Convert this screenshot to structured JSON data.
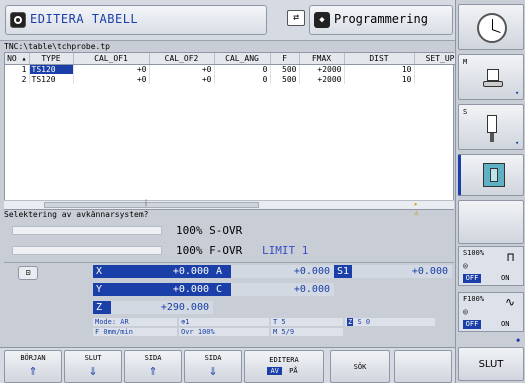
{
  "title": {
    "mode_left": "EDITERA TABELL",
    "mode_right": "Programmering"
  },
  "file_path": "TNC:\\table\\tchprobe.tp",
  "table": {
    "columns": [
      "NO",
      "TYPE",
      "CAL_OF1",
      "CAL_OF2",
      "CAL_ANG",
      "F",
      "FMAX",
      "DIST",
      "SET_UP"
    ],
    "rows": [
      [
        "1",
        "TS120",
        "+0",
        "+0",
        "0",
        "500",
        "+2000",
        "10",
        ""
      ],
      [
        "2",
        "TS120",
        "+0",
        "+0",
        "0",
        "500",
        "+2000",
        "10",
        ""
      ]
    ]
  },
  "scroll_marker": "║",
  "message": "Selektering av avkännarsystem?",
  "override": {
    "s_ovr": "100% S-OVR",
    "f_ovr": "100% F-OVR",
    "limit": "LIMIT 1",
    "s_ovr_level": 100,
    "f_ovr_level": 100
  },
  "positions": {
    "x_label": "X",
    "x_value": "+0.000",
    "a_label": "A",
    "a_value": "+0.000",
    "s1_label": "S1",
    "s1_value": "+0.000",
    "y_label": "Y",
    "y_value": "+0.000",
    "c_label": "C",
    "c_value": "+0.000",
    "z_label": "Z",
    "z_value": "+290.000"
  },
  "status": {
    "mode": "Mode: ÄR",
    "plane": "1",
    "t": "T 5",
    "s": "S 0",
    "feed": "F 0mm/min",
    "ovr": "Ovr 100%",
    "m": "M 5/9"
  },
  "softkeys": {
    "begin": "BÖRJAN",
    "end": "SLUT",
    "page_up": "SIDA",
    "page_down": "SIDA",
    "edit": "EDITERA",
    "edit_av": "AV",
    "edit_pa": "PÅ",
    "search": "SÖK",
    "end_right": "SLUT"
  },
  "right_panel": {
    "m_label": "M",
    "s_label": "S",
    "s100": "S100%",
    "f100": "F100%",
    "off": "OFF",
    "on": "ON"
  },
  "colors": {
    "accent": "#1a3fa8",
    "panel": "#c9ced6"
  },
  "icons": [
    "clock-icon",
    "spindle-icon",
    "tool-icon",
    "probe-icon",
    "swap-icon",
    "program-icon"
  ]
}
